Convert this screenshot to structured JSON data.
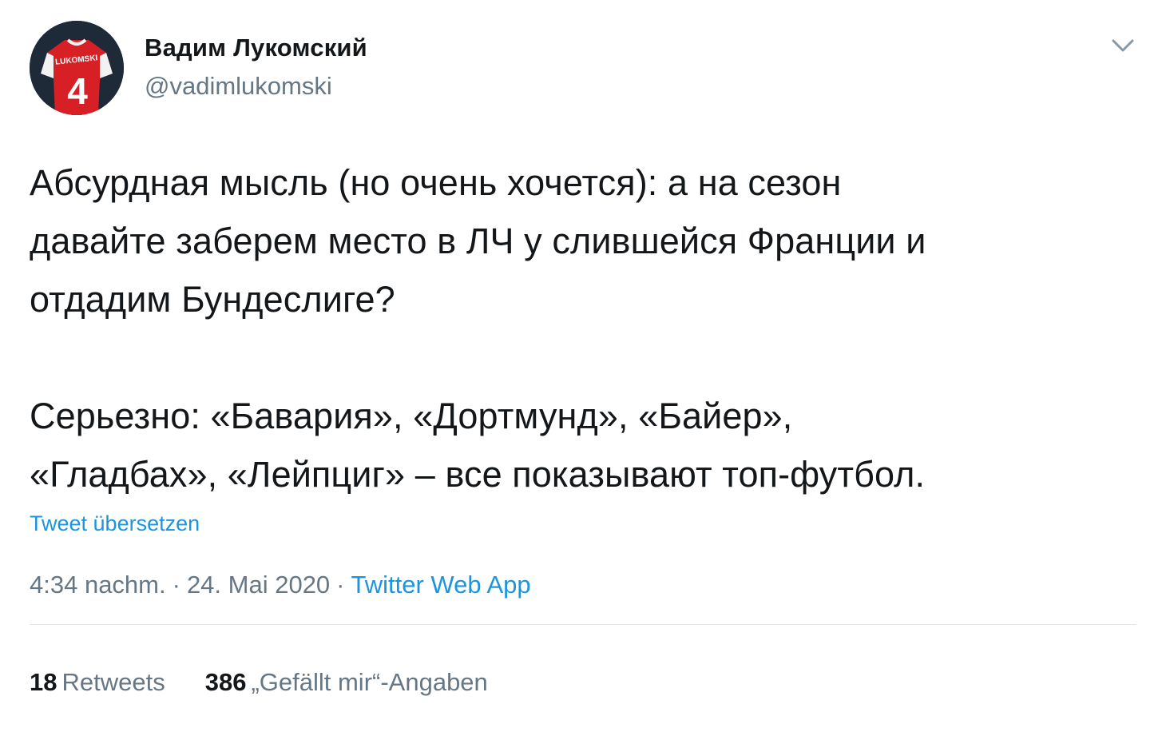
{
  "author": {
    "display_name": "Вадим Лукомский",
    "handle": "@vadimlukomski",
    "avatar_jersey_text": "LUKOMSKI",
    "avatar_jersey_number": "4"
  },
  "tweet": {
    "text": "Абсурдная мысль (но очень хочется): а на сезон\nдавайте заберем место в ЛЧ у слившейся Франции и\nотдадим Бундеслиге?\n\nСерьезно: «Бавария», «Дортмунд», «Байер»,\n«Гладбах», «Лейпциг» – все показывают топ-футбол.",
    "translate_label": "Tweet übersetzen",
    "time": "4:34 nachm.",
    "date": "24. Mai 2020",
    "separator": "·",
    "source": "Twitter Web App"
  },
  "stats": {
    "retweets_count": "18",
    "retweets_label": "Retweets",
    "likes_count": "386",
    "likes_label": "„Gefällt mir“-Angaben"
  },
  "icons": {
    "caret": "chevron-down-icon"
  },
  "colors": {
    "text": "#14171a",
    "secondary": "#657786",
    "link": "#1b95e0",
    "divider": "#e1e8ed"
  }
}
